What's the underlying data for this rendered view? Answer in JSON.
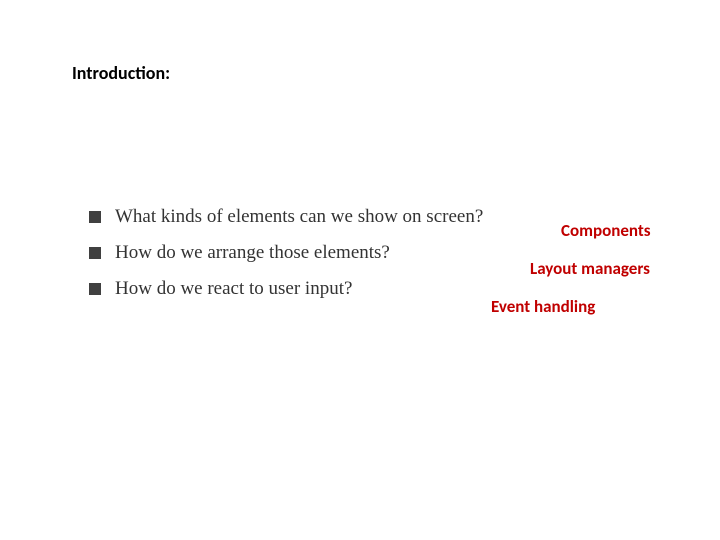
{
  "heading": "Introduction:",
  "bullets": {
    "q1": "What kinds of elements can we show on screen?",
    "q2": "How do we arrange those elements?",
    "q3": "How do we react to user input?"
  },
  "answers": {
    "a1": "Components",
    "a2": "Layout managers",
    "a3": "Event handling"
  }
}
